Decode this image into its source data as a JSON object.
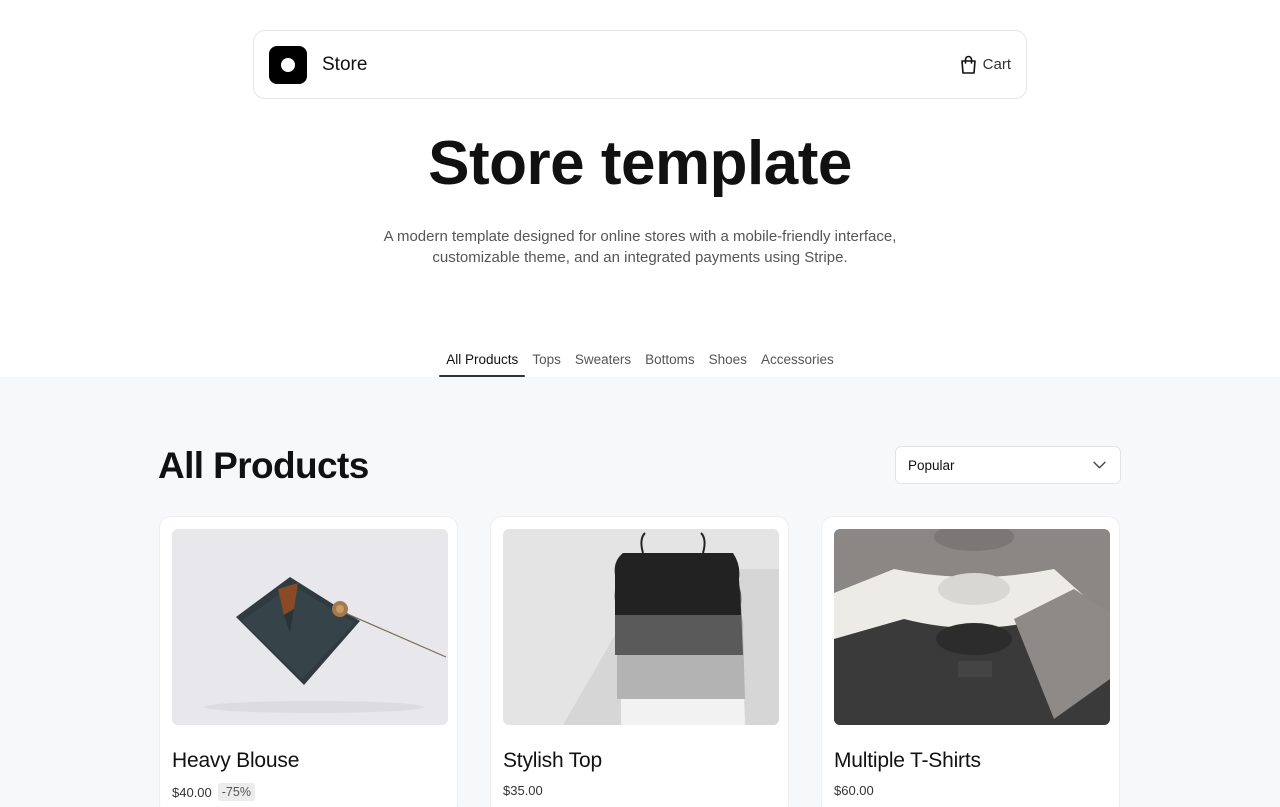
{
  "header": {
    "brand": "Store",
    "cart_label": "Cart"
  },
  "hero": {
    "title": "Store template",
    "subtitle": "A modern template designed for online stores with a mobile-friendly interface, customizable theme, and an integrated payments using Stripe."
  },
  "tabs": [
    {
      "label": "All Products",
      "active": true
    },
    {
      "label": "Tops",
      "active": false
    },
    {
      "label": "Sweaters",
      "active": false
    },
    {
      "label": "Bottoms",
      "active": false
    },
    {
      "label": "Shoes",
      "active": false
    },
    {
      "label": "Accessories",
      "active": false
    }
  ],
  "main": {
    "title": "All Products",
    "sort": {
      "selected": "Popular"
    }
  },
  "products": [
    {
      "name": "Heavy Blouse",
      "price": "$40.00",
      "discount": "-75%"
    },
    {
      "name": "Stylish Top",
      "price": "$35.00"
    },
    {
      "name": "Multiple T-Shirts",
      "price": "$60.00"
    }
  ],
  "icons": {
    "logo": "store-logo-icon",
    "cart": "shopping-bag-icon",
    "sort": "chevron-down-icon"
  }
}
